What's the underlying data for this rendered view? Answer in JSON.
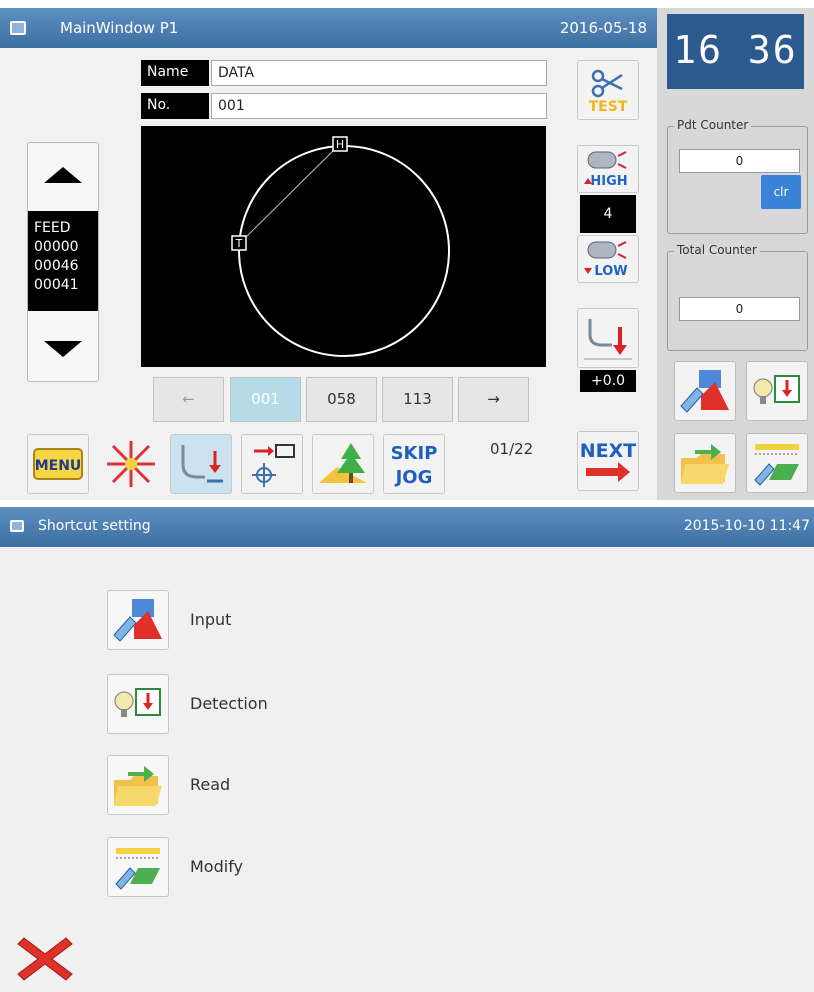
{
  "main_window": {
    "title": "MainWindow P1",
    "date": "2016-05-18",
    "fields": [
      {
        "label": "Name",
        "value": "DATA"
      },
      {
        "label": "No.",
        "value": "001"
      }
    ],
    "canvas": {
      "start_marker": "H",
      "end_marker": "T"
    },
    "feed": {
      "label": "FEED",
      "values": [
        "00000",
        "00046",
        "00041"
      ]
    },
    "pages": {
      "prev": "←",
      "items": [
        "001",
        "058",
        "113"
      ],
      "next": "→",
      "count": "01/22"
    },
    "right_tools": {
      "test_label": "TEST",
      "high_label": "HIGH",
      "speed_value": "4",
      "low_label": "LOW",
      "offset_value": "+0.0",
      "next_label": "NEXT"
    },
    "bottom_tools": {
      "menu_label": "MENU",
      "skip_label": "SKIP",
      "jog_label": "JOG"
    }
  },
  "status_panel": {
    "clock": "16 36",
    "pdt_counter": {
      "title": "Pdt Counter",
      "value": "0",
      "clear_label": "clr"
    },
    "total_counter": {
      "title": "Total Counter",
      "value": "0"
    }
  },
  "shortcut_window": {
    "title": "Shortcut setting",
    "datetime": "2015-10-10 11:47",
    "items": [
      {
        "label": "Input",
        "icon": "input-icon"
      },
      {
        "label": "Detection",
        "icon": "detection-icon"
      },
      {
        "label": "Read",
        "icon": "read-folder-icon"
      },
      {
        "label": "Modify",
        "icon": "modify-icon"
      }
    ]
  },
  "colors": {
    "titlebar": "#4a7db3",
    "clock_bg": "#2c5a8f",
    "accent_red": "#e0302a",
    "accent_green": "#4caf50"
  }
}
